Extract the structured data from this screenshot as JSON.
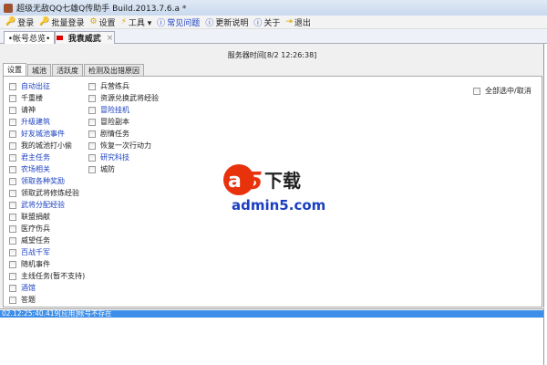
{
  "window": {
    "title": "超级无敌QQ七雄Q传助手 Build.2013.7.6.a *"
  },
  "toolbar": [
    {
      "label": "登录",
      "icon": "key-icon"
    },
    {
      "label": "批量登录",
      "icon": "key-icon"
    },
    {
      "label": "设置",
      "icon": "settings-icon"
    },
    {
      "label": "工具 ▾",
      "icon": "lightning-icon"
    },
    {
      "label": "常见问题",
      "icon": "info-icon",
      "highlight": true
    },
    {
      "label": "更新说明",
      "icon": "info-icon"
    },
    {
      "label": "关于",
      "icon": "info-icon"
    },
    {
      "label": "退出",
      "icon": "exit-icon"
    }
  ],
  "tabs": {
    "overview": "•帐号总览•",
    "account": "我袁威武",
    "close": "×"
  },
  "server_time": "服务器时间[8/2 12:26:38]",
  "inner_tabs": [
    "设置",
    "城池",
    "活跃度",
    "检测及出错原因"
  ],
  "select_all": "全部选中/取消",
  "left_options": [
    {
      "label": "自动出征",
      "blue": true
    },
    {
      "label": "千重楼",
      "blue": false
    },
    {
      "label": "请神",
      "blue": false
    },
    {
      "label": "升级建筑",
      "blue": true
    },
    {
      "label": "好友城池事件",
      "blue": true
    },
    {
      "label": "我的城池打小偷",
      "blue": false
    },
    {
      "label": "君主任务",
      "blue": true
    },
    {
      "label": "农场相关",
      "blue": true
    },
    {
      "label": "领取各种奖励",
      "blue": true
    },
    {
      "label": "领取武将修炼经验",
      "blue": false
    },
    {
      "label": "武将分配经验",
      "blue": true
    },
    {
      "label": "联盟捐献",
      "blue": false
    },
    {
      "label": "医疗伤兵",
      "blue": false
    },
    {
      "label": "威望任务",
      "blue": false
    },
    {
      "label": "百战千军",
      "blue": true
    },
    {
      "label": "随机事件",
      "blue": false
    },
    {
      "label": "主线任务(暂不支持)",
      "blue": false
    },
    {
      "label": "酒馆",
      "blue": true
    },
    {
      "label": "答题",
      "blue": false
    }
  ],
  "right_options": [
    {
      "label": "兵营练兵",
      "blue": false
    },
    {
      "label": "资源兑换武将经验",
      "blue": false
    },
    {
      "label": "冒险挂机",
      "blue": true
    },
    {
      "label": "冒险副本",
      "blue": false
    },
    {
      "label": "剧情任务",
      "blue": false
    },
    {
      "label": "恢复一次行动力",
      "blue": false
    },
    {
      "label": "研究科技",
      "blue": true
    },
    {
      "label": "城防",
      "blue": false
    }
  ],
  "log": [
    "02.12:25:40.419[应用]帐号不存在"
  ],
  "watermark": {
    "logo": "a5下载",
    "url": "admin5.com"
  }
}
